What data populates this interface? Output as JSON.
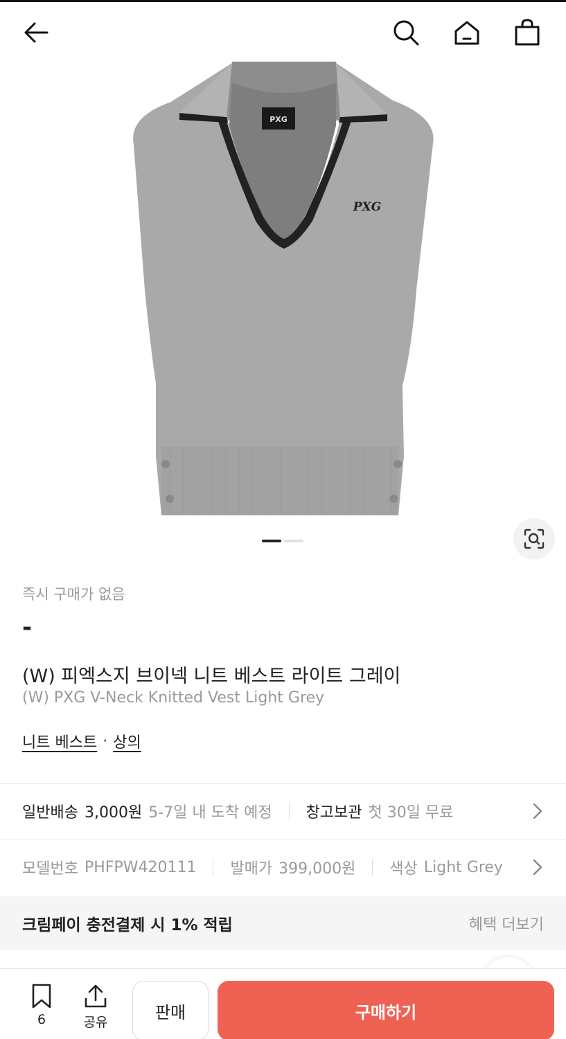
{
  "colors": {
    "accent": "#ef6253",
    "text_primary": "#222222",
    "text_muted": "#9a9a9a",
    "banner_bg": "#f5f5f5"
  },
  "header": {
    "back_icon": "arrow-left-icon",
    "search_icon": "search-icon",
    "home_icon": "home-icon",
    "bag_icon": "shopping-bag-icon"
  },
  "gallery": {
    "image_count": 2,
    "active_index": 0,
    "lens_icon": "image-search-icon"
  },
  "product": {
    "instant_buy_label": "즉시 구매가 없음",
    "price": "-",
    "title_ko": "(W) 피엑스지 브이넥 니트 베스트 라이트 그레이",
    "title_en": "(W) PXG V-Neck Knitted Vest Light Grey",
    "categories": [
      "니트 베스트",
      "상의"
    ],
    "category_sep": "·"
  },
  "shipping": {
    "label": "일반배송",
    "fee": "3,000원",
    "eta": "5-7일 내 도착 예정",
    "storage_label": "창고보관",
    "storage_value": "첫 30일 무료"
  },
  "details": {
    "model_label": "모델번호",
    "model_value": "PHFPW420111",
    "release_price_label": "발매가",
    "release_price_value": "399,000원",
    "color_label": "색상",
    "color_value": "Light Grey"
  },
  "benefit": {
    "label": "크림페이 충전결제 시 1% 적립",
    "more": "혜택 더보기"
  },
  "bottom_bar": {
    "bookmark_count": "6",
    "share_label": "공유",
    "sell_label": "판매",
    "buy_label": "구매하기"
  }
}
